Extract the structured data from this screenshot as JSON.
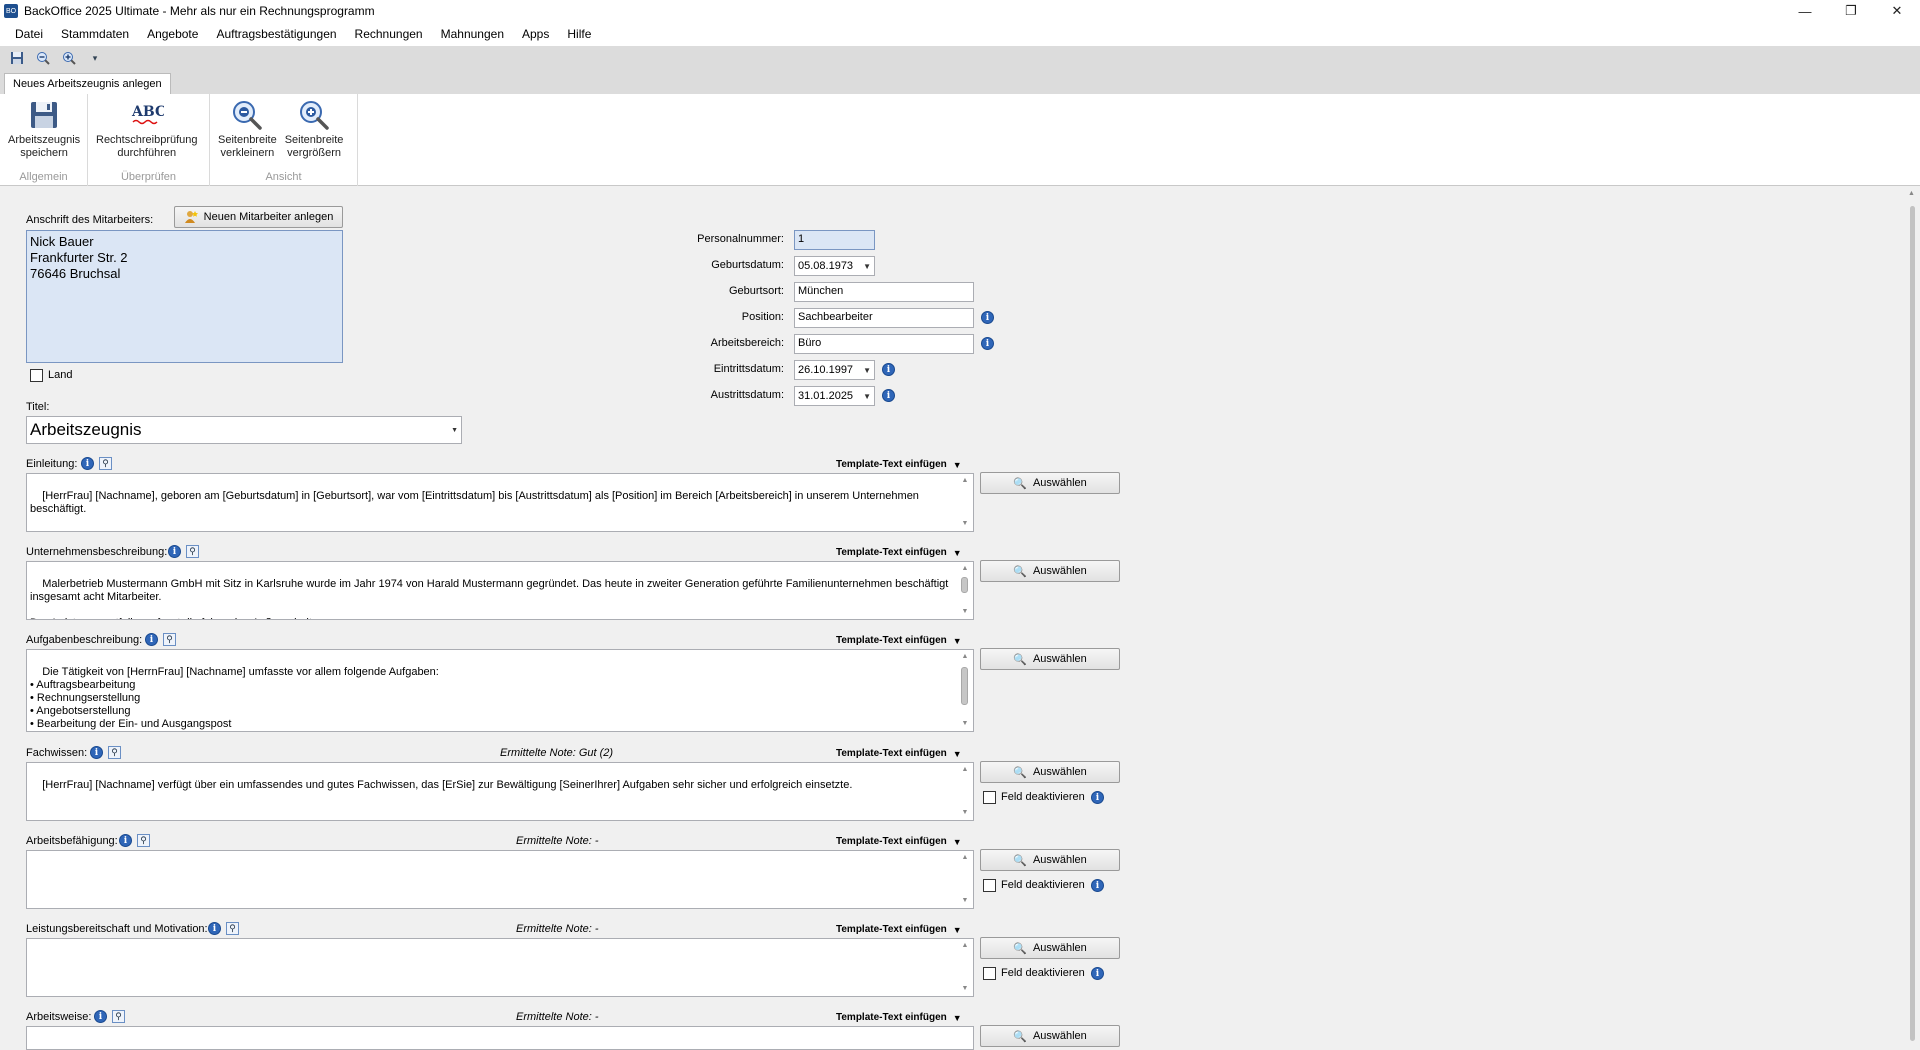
{
  "window": {
    "icon_text": "BO",
    "title": "BackOffice 2025 Ultimate - Mehr als nur ein Rechnungsprogramm"
  },
  "menu": [
    "Datei",
    "Stammdaten",
    "Angebote",
    "Auftragsbestätigungen",
    "Rechnungen",
    "Mahnungen",
    "Apps",
    "Hilfe"
  ],
  "tab": "Neues Arbeitszeugnis anlegen",
  "ribbon": {
    "groups": [
      {
        "label": "Allgemein",
        "buttons": [
          {
            "line1": "Arbeitszeugnis",
            "line2": "speichern",
            "icon": "save-icon"
          }
        ]
      },
      {
        "label": "Überprüfen",
        "buttons": [
          {
            "line1": "Rechtschreibprüfung",
            "line2": "durchführen",
            "icon": "spellcheck-icon"
          }
        ]
      },
      {
        "label": "Ansicht",
        "buttons": [
          {
            "line1": "Seitenbreite",
            "line2": "verkleinern",
            "icon": "zoom-out-icon"
          },
          {
            "line1": "Seitenbreite",
            "line2": "vergrößern",
            "icon": "zoom-in-icon"
          }
        ]
      }
    ],
    "spell_icon_text": "ABC"
  },
  "address": {
    "label": "Anschrift des Mitarbeiters:",
    "new_button": "Neuen Mitarbeiter anlegen",
    "lines": [
      "Nick Bauer",
      "Frankfurter Str. 2",
      "76646 Bruchsal"
    ],
    "country_label": "Land",
    "country_checked": false
  },
  "employee": {
    "personalnummer_label": "Personalnummer:",
    "personalnummer": "1",
    "geburtsdatum_label": "Geburtsdatum:",
    "geburtsdatum": "05.08.1973",
    "geburtsort_label": "Geburtsort:",
    "geburtsort": "München",
    "position_label": "Position:",
    "position": "Sachbearbeiter",
    "arbeitsbereich_label": "Arbeitsbereich:",
    "arbeitsbereich": "Büro",
    "eintritt_label": "Eintrittsdatum:",
    "eintritt": "26.10.1997",
    "austritt_label": "Austrittsdatum:",
    "austritt": "31.01.2025"
  },
  "titel": {
    "label": "Titel:",
    "value": "Arbeitszeugnis"
  },
  "common": {
    "template_text": "Template-Text einfügen",
    "select_button": "Auswählen",
    "deactivate_label": "Feld deaktivieren"
  },
  "sections": {
    "einleitung": {
      "label": "Einleitung:",
      "text": "[HerrFrau] [Nachname], geboren am [Geburtsdatum] in [Geburtsort], war vom [Eintrittsdatum] bis [Austrittsdatum] als [Position] im Bereich [Arbeitsbereich] in unserem Unternehmen beschäftigt."
    },
    "unternehmen": {
      "label": "Unternehmensbeschreibung:",
      "text": "Malerbetrieb Mustermann GmbH mit Sitz in Karlsruhe wurde im Jahr 1974 von Harald Mustermann gegründet. Das heute in zweiter Generation geführte Familienunternehmen beschäftigt insgesamt acht Mitarbeiter.\n\nDas Leistungsportfolio umfasst die folgenden Außenarbeiten:\n• Vollwärmeschutzarbeiten"
    },
    "aufgaben": {
      "label": "Aufgabenbeschreibung:",
      "text": "Die Tätigkeit von [HerrnFrau] [Nachname] umfasste vor allem folgende Aufgaben:\n• Auftragsbearbeitung\n• Rechnungserstellung\n• Angebotserstellung\n• Bearbeitung der Ein- und Ausgangspost\n• Kundenstammverwaltung & Kundenbetreuung\n• Terminplanung"
    },
    "fachwissen": {
      "label": "Fachwissen:",
      "note": "Ermittelte Note: Gut (2)",
      "text": "[HerrFrau] [Nachname] verfügt über ein umfassendes und gutes Fachwissen, das [ErSie] zur Bewältigung [SeinerIhrer] Aufgaben sehr sicher und erfolgreich einsetzte."
    },
    "befaehigung": {
      "label": "Arbeitsbefähigung:",
      "note": "Ermittelte Note: -",
      "text": ""
    },
    "leistung": {
      "label": "Leistungsbereitschaft und Motivation:",
      "note": "Ermittelte Note: -",
      "text": ""
    },
    "arbeitsweise": {
      "label": "Arbeitsweise:",
      "note": "Ermittelte Note: -",
      "text": ""
    }
  }
}
